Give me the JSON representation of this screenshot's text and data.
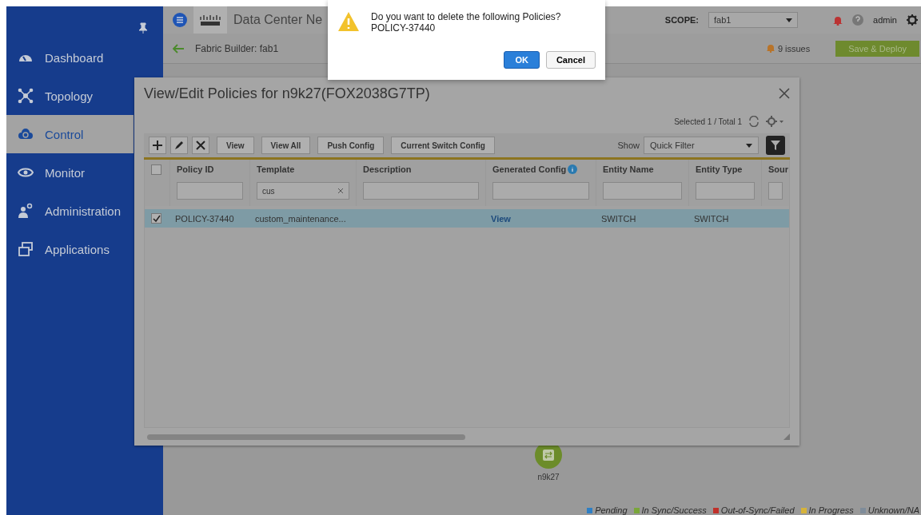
{
  "sidebar": {
    "items": [
      {
        "label": "Dashboard",
        "selected": false
      },
      {
        "label": "Topology",
        "selected": false
      },
      {
        "label": "Control",
        "selected": true
      },
      {
        "label": "Monitor",
        "selected": false
      },
      {
        "label": "Administration",
        "selected": false
      },
      {
        "label": "Applications",
        "selected": false
      }
    ]
  },
  "topbar": {
    "app_title": "Data Center Ne",
    "scope_label": "SCOPE:",
    "scope_value": "fab1",
    "user": "admin"
  },
  "subbar": {
    "breadcrumb": "Fabric Builder: fab1",
    "issues": "9 issues",
    "deploy_button": "Save & Deploy"
  },
  "policy_dialog": {
    "title": "View/Edit Policies for n9k27(FOX2038G7TP)",
    "selection_count": "Selected 1 / Total 1",
    "toolbar_buttons": [
      "View",
      "View All",
      "Push Config",
      "Current Switch Config"
    ],
    "show_label": "Show",
    "filter_mode": "Quick Filter",
    "table": {
      "header_checked": false,
      "columns": [
        {
          "label": "Policy ID"
        },
        {
          "label": "Template",
          "filter": "cus"
        },
        {
          "label": "Description"
        },
        {
          "label": "Generated Config",
          "has_info": true
        },
        {
          "label": "Entity Name"
        },
        {
          "label": "Entity Type"
        },
        {
          "label": "Sour"
        }
      ],
      "rows": [
        {
          "checked": true,
          "selected": true,
          "cells": [
            {
              "text": "POLICY-37440",
              "kind": "text"
            },
            {
              "text": "custom_maintenance...",
              "kind": "text"
            },
            null,
            {
              "text": "View",
              "kind": "link"
            },
            {
              "text": "SWITCH",
              "kind": "text"
            },
            {
              "text": "SWITCH",
              "kind": "text"
            },
            null
          ]
        }
      ]
    }
  },
  "topology": {
    "node_label": "n9k27"
  },
  "legend": [
    {
      "label": "Pending",
      "color": "#2f7fc4"
    },
    {
      "label": "In Sync/Success",
      "color": "#7aa63a"
    },
    {
      "label": "Out-of-Sync/Failed",
      "color": "#c0302a"
    },
    {
      "label": "In Progress",
      "color": "#d6b33a"
    },
    {
      "label": "Unknown/NA",
      "color": "#7f8c9a"
    }
  ],
  "alert": {
    "message": "Do you want to delete the following Policies?",
    "item": "POLICY-37440",
    "ok_button": "OK",
    "cancel_button": "Cancel"
  }
}
